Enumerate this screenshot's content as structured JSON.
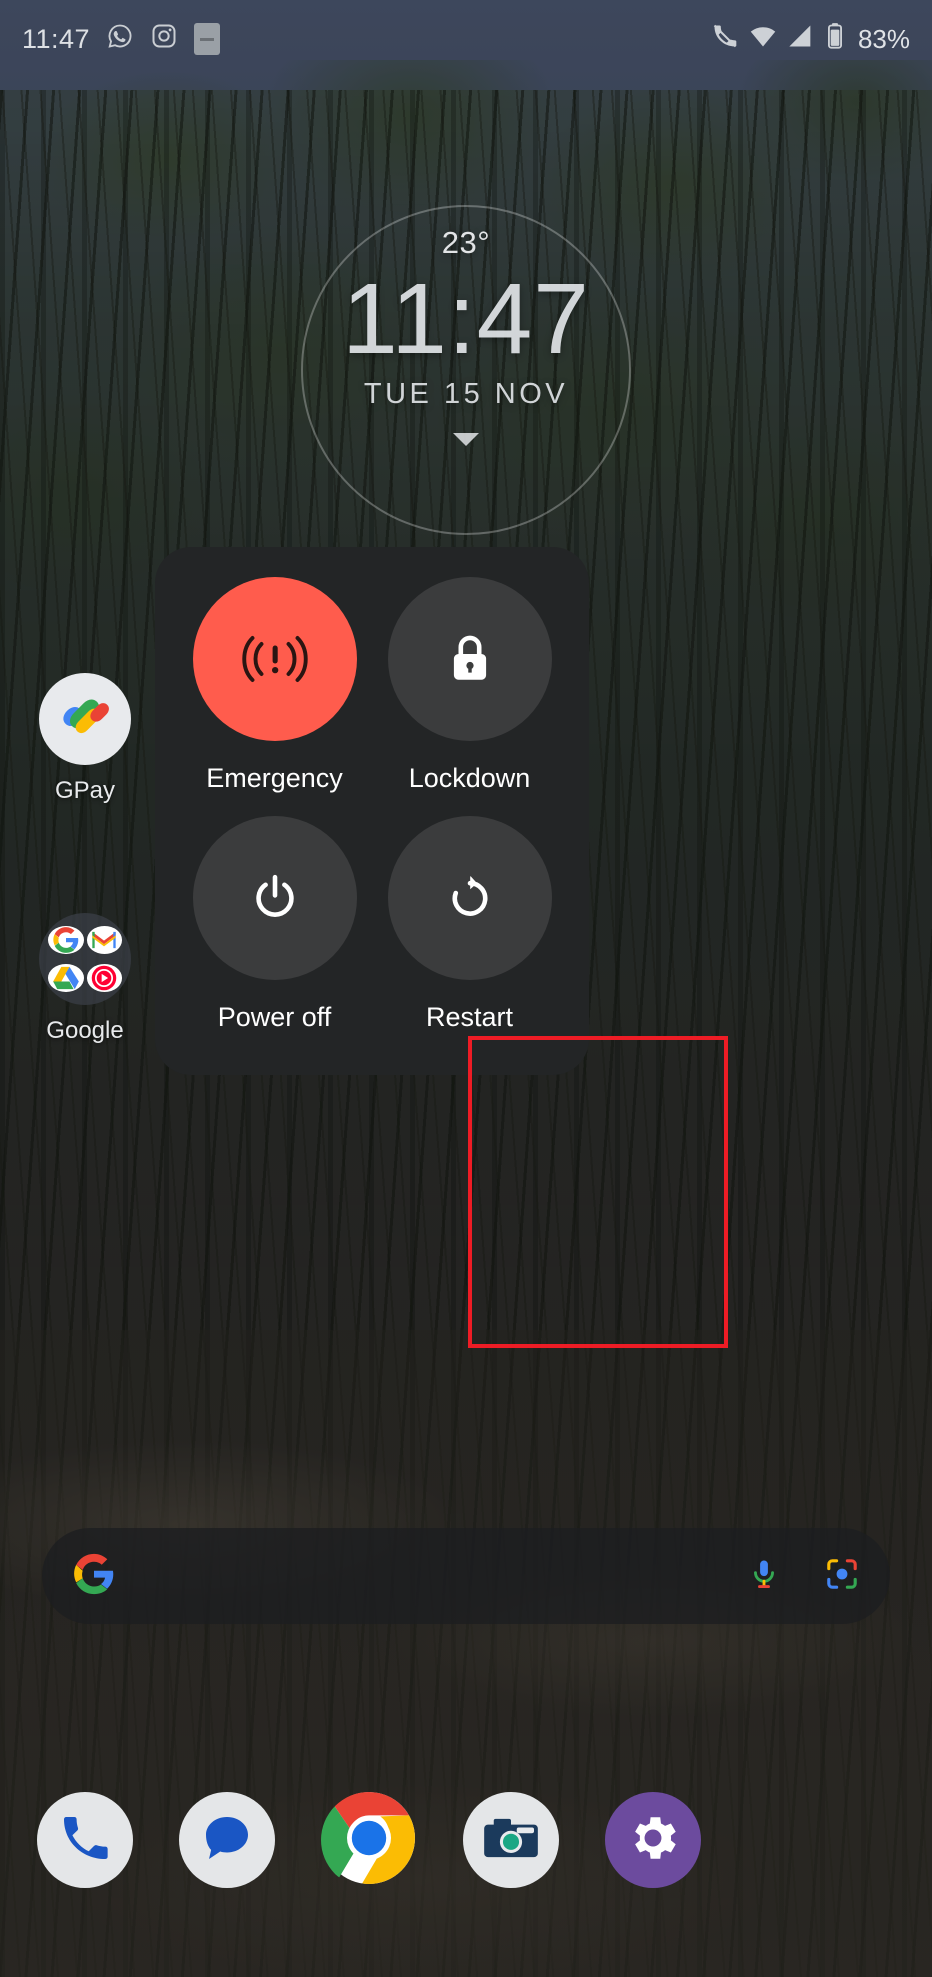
{
  "statusbar": {
    "time": "11:47",
    "left_icons": [
      "whatsapp-icon",
      "instagram-icon",
      "screen-record-icon"
    ],
    "right_icons": [
      "call-mute-icon",
      "wifi-icon",
      "mobile-signal-icon",
      "battery-icon"
    ],
    "battery_percent": "83%"
  },
  "clock_widget": {
    "temperature": "23°",
    "time": "11:47",
    "date": "TUE  15  NOV"
  },
  "home_apps": [
    {
      "id": "gpay",
      "label": "GPay",
      "icon": "gpay-icon"
    },
    {
      "id": "google",
      "label": "Google",
      "icon": "google-folder-icon"
    }
  ],
  "power_menu": {
    "items": [
      {
        "id": "emergency",
        "label": "Emergency",
        "icon": "emergency-broadcast-icon",
        "accent": "#ff5c4d",
        "highlighted": false
      },
      {
        "id": "lockdown",
        "label": "Lockdown",
        "icon": "lock-icon",
        "accent": "#3b3c3d",
        "highlighted": false
      },
      {
        "id": "power-off",
        "label": "Power off",
        "icon": "power-icon",
        "accent": "#3b3c3d",
        "highlighted": false
      },
      {
        "id": "restart",
        "label": "Restart",
        "icon": "restart-icon",
        "accent": "#3b3c3d",
        "highlighted": true
      }
    ],
    "highlight_color": "#ee1c25",
    "panel_color": "#232526"
  },
  "search_bar": {
    "logo": "google-g-icon",
    "placeholder": "",
    "value": "",
    "actions": [
      "microphone-icon",
      "google-lens-icon"
    ]
  },
  "dock": [
    {
      "id": "phone",
      "icon": "phone-icon"
    },
    {
      "id": "messages",
      "icon": "messages-icon"
    },
    {
      "id": "chrome",
      "icon": "chrome-icon"
    },
    {
      "id": "camera",
      "icon": "camera-icon"
    },
    {
      "id": "settings",
      "icon": "settings-gear-icon"
    }
  ]
}
